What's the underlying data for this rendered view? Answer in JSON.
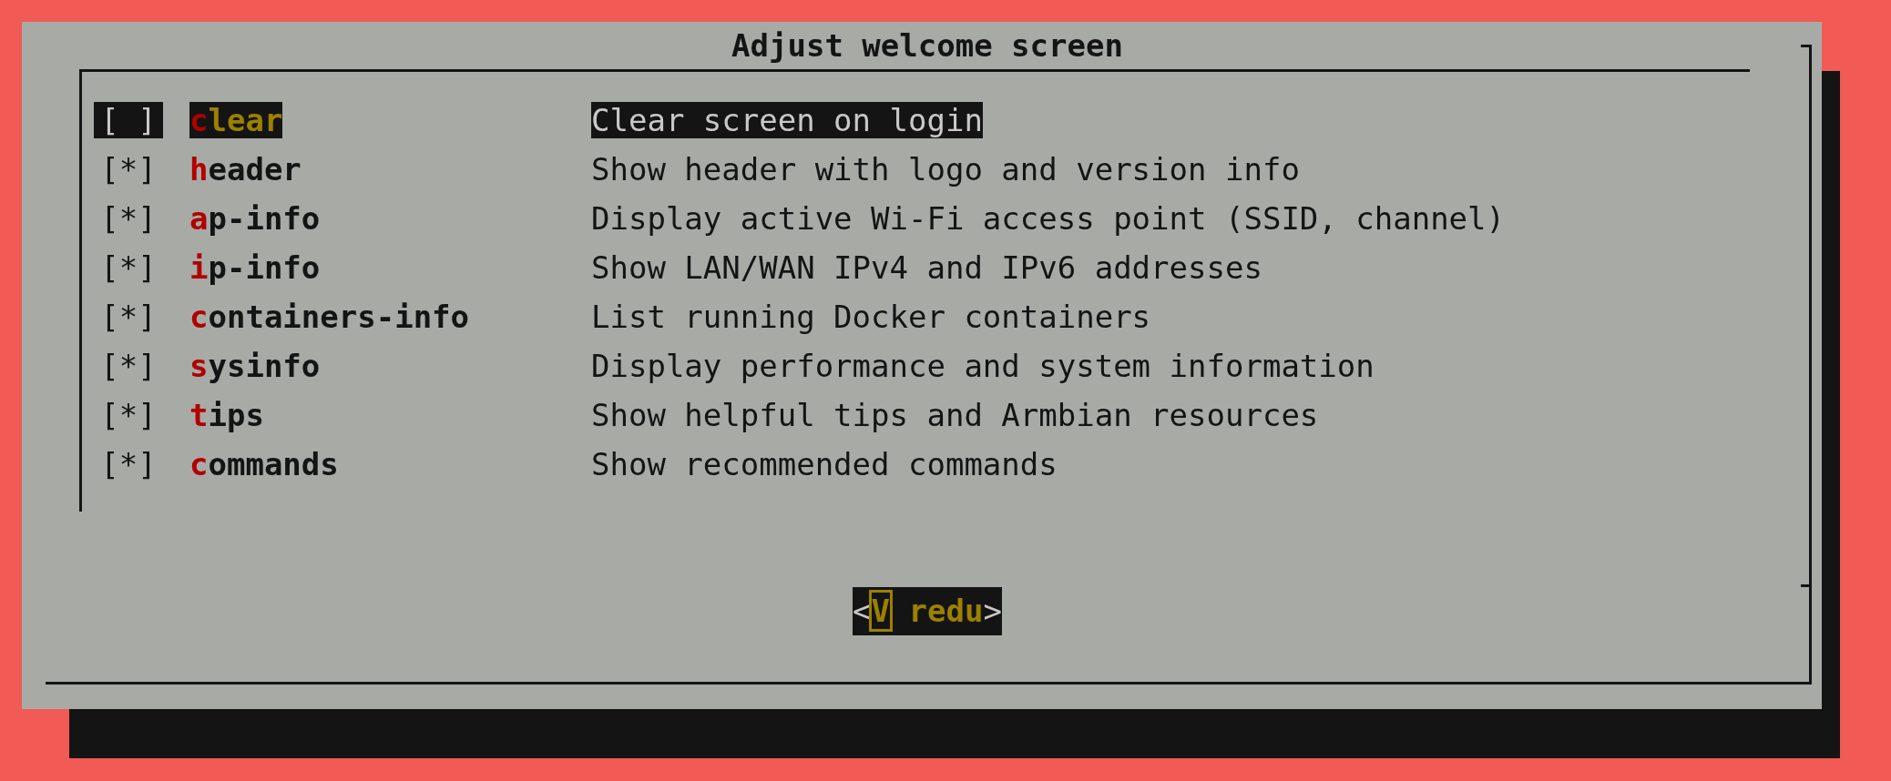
{
  "dialog": {
    "title": "Adjust welcome screen"
  },
  "items": [
    {
      "checkbox": "[ ]",
      "name": "clear",
      "description": "Clear screen on login",
      "selected": true
    },
    {
      "checkbox": "[*]",
      "name": "header",
      "description": "Show header with logo and version info",
      "selected": false
    },
    {
      "checkbox": "[*]",
      "name": "ap-info",
      "description": "Display active Wi-Fi access point (SSID, channel)",
      "selected": false
    },
    {
      "checkbox": "[*]",
      "name": "ip-info",
      "description": "Show LAN/WAN IPv4 and IPv6 addresses",
      "selected": false
    },
    {
      "checkbox": "[*]",
      "name": "containers-info",
      "description": "List running Docker containers",
      "selected": false
    },
    {
      "checkbox": "[*]",
      "name": "sysinfo",
      "description": "Display performance and system information",
      "selected": false
    },
    {
      "checkbox": "[*]",
      "name": "tips",
      "description": "Show helpful tips and Armbian resources",
      "selected": false
    },
    {
      "checkbox": "[*]",
      "name": "commands",
      "description": "Show recommended commands",
      "selected": false
    }
  ],
  "button": {
    "label": "<V redu>",
    "focused": true
  }
}
